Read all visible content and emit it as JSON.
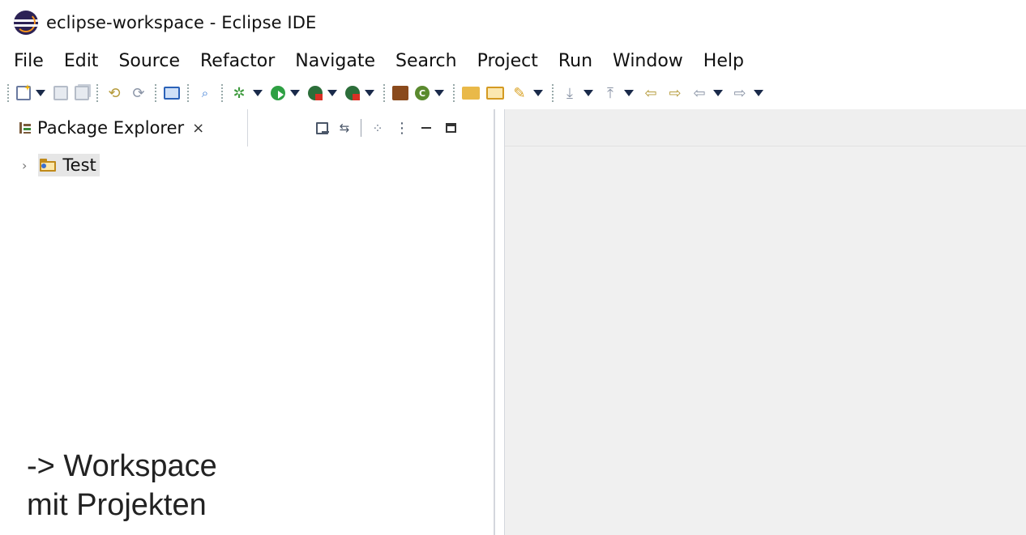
{
  "window": {
    "title": "eclipse-workspace - Eclipse IDE"
  },
  "menubar": {
    "items": [
      "File",
      "Edit",
      "Source",
      "Refactor",
      "Navigate",
      "Search",
      "Project",
      "Run",
      "Window",
      "Help"
    ]
  },
  "toolbar": {
    "icons": [
      "new-icon",
      "save-icon",
      "save-all-icon",
      "undo-icon",
      "redo-icon",
      "console-icon",
      "search-icon",
      "debug-icon",
      "run-icon",
      "run-as-icon",
      "coverage-icon",
      "new-class-icon",
      "new-java-package-icon",
      "open-type-icon",
      "open-folder-icon",
      "pen-icon",
      "next-annotation-icon",
      "prev-annotation-icon",
      "back-icon",
      "forward-icon"
    ]
  },
  "package_explorer": {
    "tab_label": "Package Explorer",
    "close_glyph": "×",
    "tree": [
      {
        "label": "Test",
        "expanded": false,
        "selected": true
      }
    ]
  },
  "caption": {
    "line1": "-> Workspace",
    "line2": "mit Projekten"
  },
  "colors": {
    "selection": "#e6e6e6",
    "editor_bg": "#f0f0f0",
    "eclipse_purple": "#2c2255",
    "eclipse_orange": "#f7941e"
  }
}
